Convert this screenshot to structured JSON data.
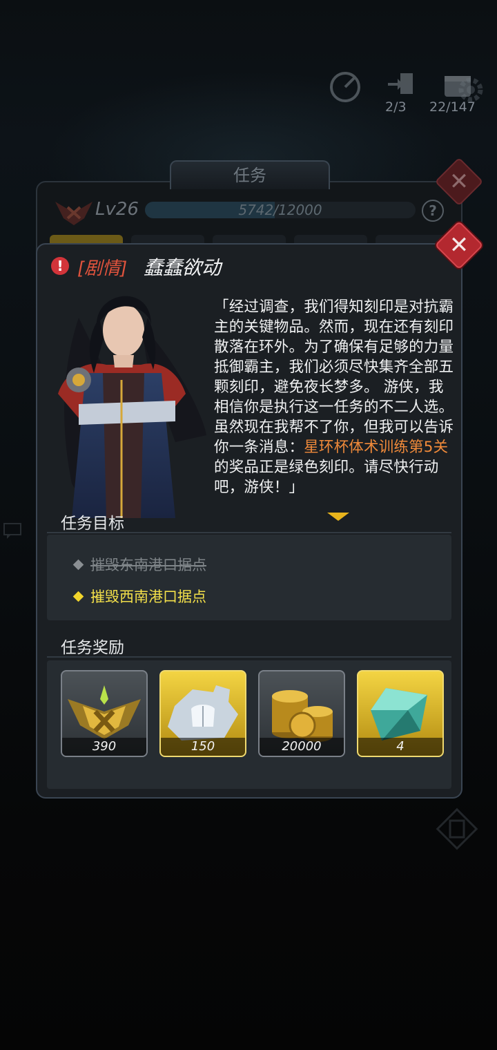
{
  "hud": {
    "counts": [
      {
        "icon": "energy-door-icon",
        "value": "2/3"
      },
      {
        "icon": "calendar-icon",
        "value": "22/147"
      }
    ]
  },
  "task_panel": {
    "tab_label": "任务",
    "level": "Lv26",
    "xp_text": "5742/12000",
    "xp_progress": 0.4785,
    "help": "?"
  },
  "mission": {
    "tag": "[剧情]",
    "title": "蠢蠢欲动",
    "dialogue_before": "「经过调查，我们得知刻印是对抗霸主的关键物品。然而，现在还有刻印散落在环外。为了确保有足够的力量抵御霸主，我们必须尽快集齐全部五颗刻印，避免夜长梦多。 游侠，我相信你是执行这一任务的不二人选。虽然现在我帮不了你，但我可以告诉你一条消息：",
    "dialogue_highlight": "星环杯体术训练第5关",
    "dialogue_after": "的奖品正是绿色刻印。请尽快行动吧，游侠！」",
    "close": "✕"
  },
  "objectives": {
    "label": "任务目标",
    "items": [
      {
        "text": "摧毁东南港口据点",
        "status": "done"
      },
      {
        "text": "摧毁西南港口据点",
        "status": "active"
      }
    ]
  },
  "rewards": {
    "label": "任务奖励",
    "items": [
      {
        "icon": "medal-badge-icon",
        "count": "390",
        "frame": "gray"
      },
      {
        "icon": "armor-fragment-icon",
        "count": "150",
        "frame": "gold"
      },
      {
        "icon": "gold-coins-icon",
        "count": "20000",
        "frame": "gray"
      },
      {
        "icon": "green-crystal-icon",
        "count": "4",
        "frame": "gold"
      }
    ]
  },
  "colors": {
    "accent_gold": "#f1d52c",
    "story_red": "#e0533d",
    "highlight_orange": "#f08a3a",
    "close_red": "#b3282f"
  }
}
